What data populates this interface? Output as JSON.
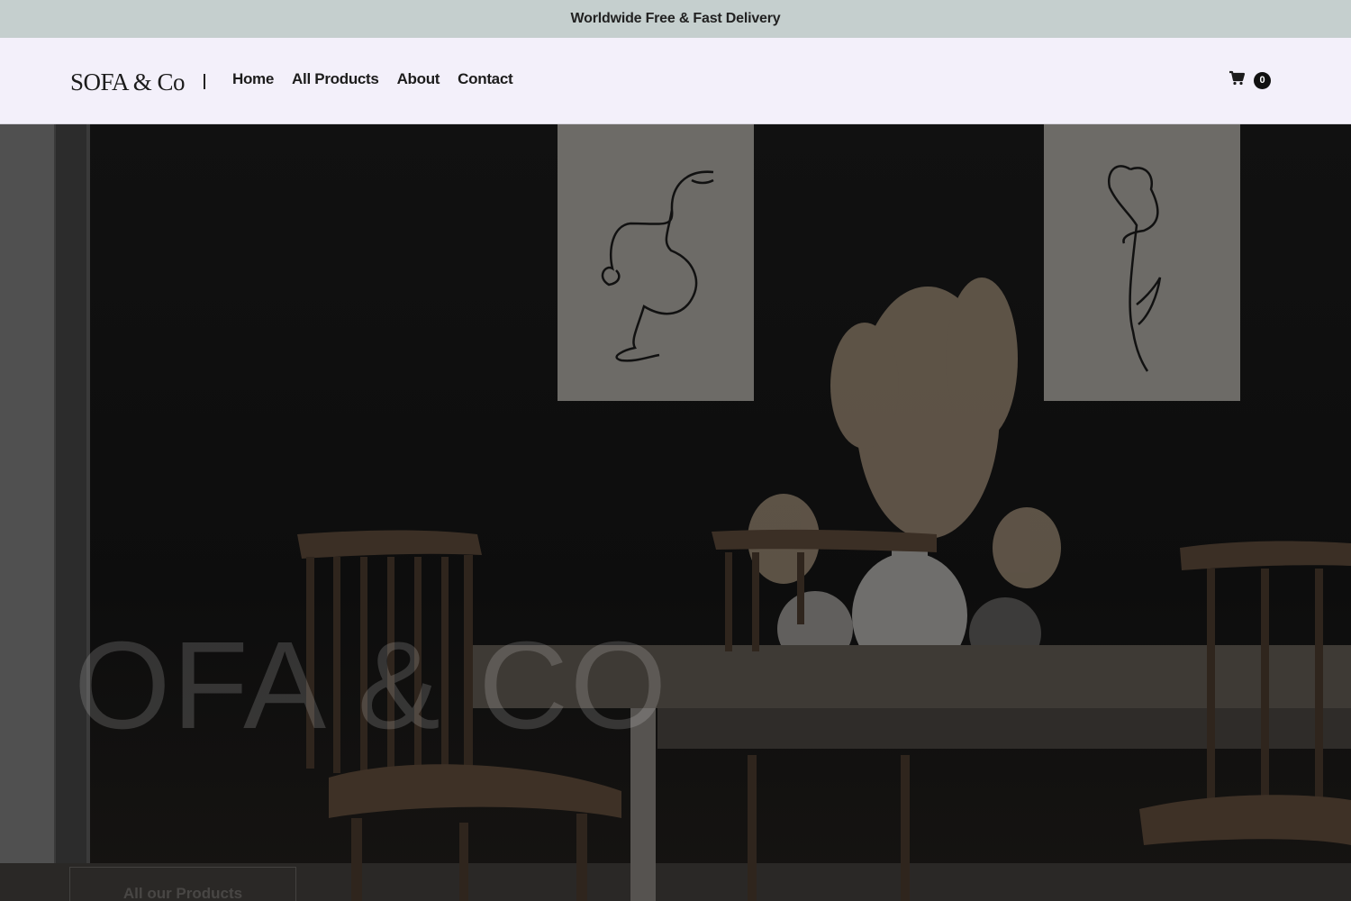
{
  "announcement": {
    "text": "Worldwide Free & Fast Delivery"
  },
  "header": {
    "logo": "SOFA & Co",
    "divider": "|",
    "nav": [
      {
        "label": "Home"
      },
      {
        "label": "All Products"
      },
      {
        "label": "About"
      },
      {
        "label": "Contact"
      }
    ],
    "cart": {
      "icon": "cart-icon",
      "count": "0"
    }
  },
  "hero": {
    "title": "OFA & CO",
    "cta_label": "All our Products"
  },
  "colors": {
    "announcement_bg": "#c5cfce",
    "header_bg": "#f3f0fa",
    "text": "#1c1c1c"
  }
}
